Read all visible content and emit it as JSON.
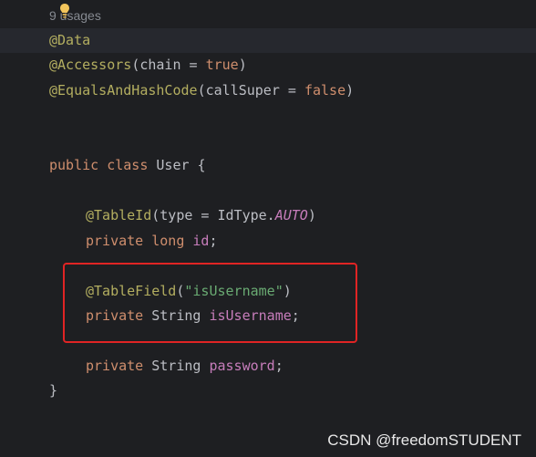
{
  "editor": {
    "usages_hint": "9 usages",
    "lines": {
      "l1_annotation": "@Data",
      "l2_annotation": "@Accessors",
      "l2_open": "(chain = ",
      "l2_value": "true",
      "l2_close": ")",
      "l3_annotation": "@EqualsAndHashCode",
      "l3_open": "(callSuper = ",
      "l3_value": "false",
      "l3_close": ")",
      "class_kw_public": "public",
      "class_kw_class": "class",
      "class_name": "User {",
      "tableid_annotation": "@TableId",
      "tableid_open": "(type = IdType.",
      "tableid_const": "AUTO",
      "tableid_close": ")",
      "id_kw_private": "private",
      "id_kw_long": "long",
      "id_field": "id",
      "id_semicolon": ";",
      "tablefield_annotation": "@TableField",
      "tablefield_open": "(",
      "tablefield_string": "\"isUsername\"",
      "tablefield_close": ")",
      "isusername_kw_private": "private",
      "isusername_type": "String",
      "isusername_field": "isUsername",
      "isusername_semicolon": ";",
      "password_kw_private": "private",
      "password_type": "String",
      "password_field": "password",
      "password_semicolon": ";",
      "close_brace": "}"
    }
  },
  "watermark": "CSDN @freedomSTUDENT",
  "colors": {
    "background": "#1e1f22",
    "keyword": "#cf8e6d",
    "annotation": "#b3ae60",
    "string": "#6aab73",
    "field": "#c77dbb",
    "highlight_box": "#e02424"
  },
  "icons": [
    "lightbulb-icon",
    "fold-chevron-icon"
  ]
}
